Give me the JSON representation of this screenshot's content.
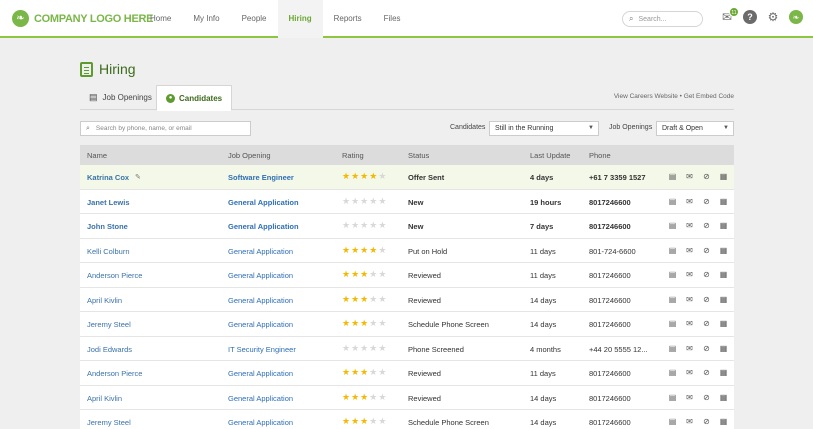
{
  "app": {
    "logo_text": "COMPANY LOGO HERE",
    "nav": [
      "Home",
      "My Info",
      "People",
      "Hiring",
      "Reports",
      "Files"
    ],
    "active_nav": "Hiring",
    "search_placeholder": "Search...",
    "notification_count": "11",
    "accent_color": "#7ab648"
  },
  "page": {
    "title": "Hiring",
    "tabs": [
      "Job Openings",
      "Candidates"
    ],
    "active_tab": "Candidates",
    "careers_link": "View Careers Website  •  Get Embed Code"
  },
  "filters": {
    "search_placeholder": "Search by phone, name, or email",
    "candidates_label": "Candidates",
    "candidates_value": "Still in the Running",
    "openings_label": "Job Openings",
    "openings_value": "Draft & Open"
  },
  "table": {
    "headers": [
      "Name",
      "Job Opening",
      "Rating",
      "Status",
      "Last Update",
      "Phone"
    ],
    "rows": [
      {
        "name": "Katrina Cox",
        "job": "Software Engineer",
        "rating": 4,
        "status": "Offer Sent",
        "last_update": "4 days",
        "phone": "+61 7 3359 1527",
        "bold": true,
        "highlight": true,
        "editable": true
      },
      {
        "name": "Janet Lewis",
        "job": "General Application",
        "rating": 0,
        "status": "New",
        "last_update": "19 hours",
        "phone": "8017246600",
        "bold": true
      },
      {
        "name": "John Stone",
        "job": "General Application",
        "rating": 0,
        "status": "New",
        "last_update": "7 days",
        "phone": "8017246600",
        "bold": true
      },
      {
        "name": "Kelli Colburn",
        "job": "General Application",
        "rating": 4,
        "status": "Put on Hold",
        "last_update": "11 days",
        "phone": "801-724-6600",
        "bold": false
      },
      {
        "name": "Anderson Pierce",
        "job": "General Application",
        "rating": 3,
        "status": "Reviewed",
        "last_update": "11 days",
        "phone": "8017246600",
        "bold": false
      },
      {
        "name": "April Kivlin",
        "job": "General Application",
        "rating": 3,
        "status": "Reviewed",
        "last_update": "14 days",
        "phone": "8017246600",
        "bold": false
      },
      {
        "name": "Jeremy Steel",
        "job": "General Application",
        "rating": 3,
        "status": "Schedule Phone Screen",
        "last_update": "14 days",
        "phone": "8017246600",
        "bold": false
      },
      {
        "name": "Jodi Edwards",
        "job": "IT Security Engineer",
        "rating": 0,
        "status": "Phone Screened",
        "last_update": "4 months",
        "phone": "+44 20 5555 12...",
        "bold": false
      },
      {
        "name": "Anderson Pierce",
        "job": "General Application",
        "rating": 3,
        "status": "Reviewed",
        "last_update": "11 days",
        "phone": "8017246600",
        "bold": false
      },
      {
        "name": "April Kivlin",
        "job": "General Application",
        "rating": 3,
        "status": "Reviewed",
        "last_update": "14 days",
        "phone": "8017246600",
        "bold": false
      },
      {
        "name": "Jeremy Steel",
        "job": "General Application",
        "rating": 3,
        "status": "Schedule Phone Screen",
        "last_update": "14 days",
        "phone": "8017246600",
        "bold": false
      }
    ],
    "row_actions": [
      "document-icon",
      "mail-icon",
      "link-icon",
      "calendar-icon"
    ]
  }
}
